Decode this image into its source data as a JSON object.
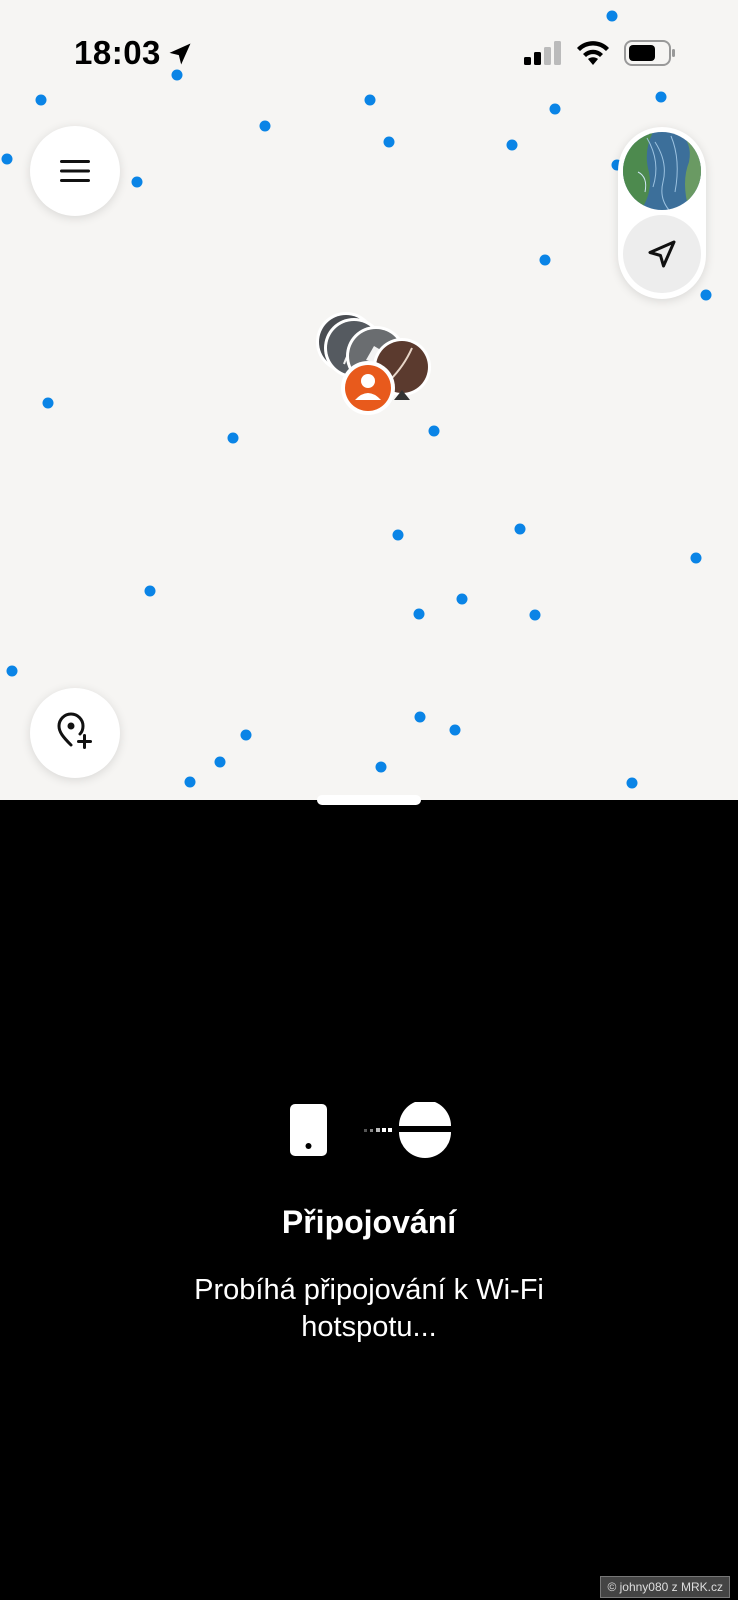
{
  "status_bar": {
    "time": "18:03",
    "icons": [
      "location-arrow-icon",
      "cellular-signal-icon",
      "wifi-icon",
      "battery-icon"
    ]
  },
  "map": {
    "background_color": "#f6f5f3",
    "point_color": "#0a84e6",
    "buttons": [
      "menu-icon",
      "add-location-icon",
      "map-layer-thumbnail",
      "locate-arrow-icon"
    ],
    "user_marker_color": "#e85a1c"
  },
  "connection_sheet": {
    "title": "Připojování",
    "message": "Probíhá připojování k Wi-Fi hotspotu..."
  },
  "watermark": "© johny080 z MRK.cz"
}
